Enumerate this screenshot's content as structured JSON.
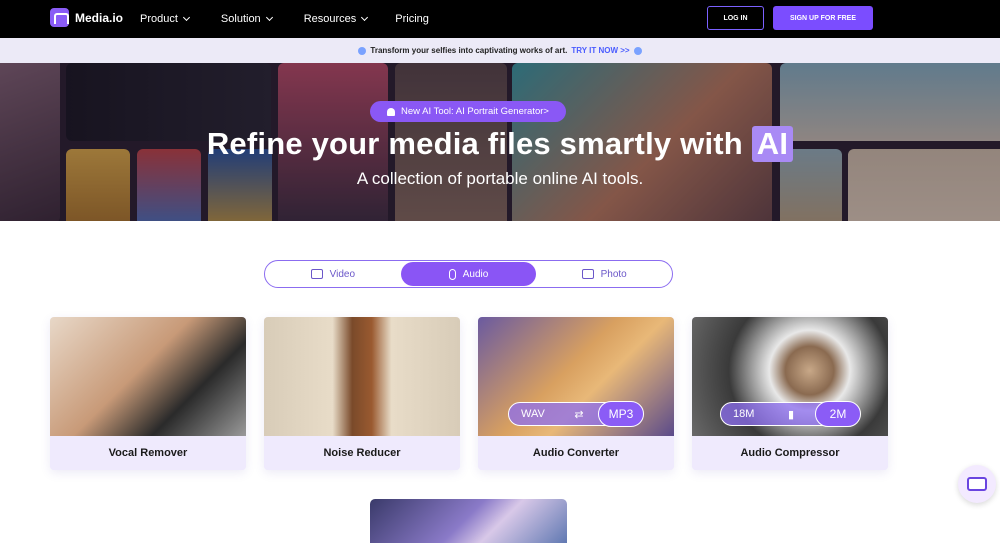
{
  "nav": {
    "logo_text": "Media.io",
    "menu": [
      {
        "label": "Product",
        "has_dropdown": true
      },
      {
        "label": "Solution",
        "has_dropdown": true
      },
      {
        "label": "Resources",
        "has_dropdown": true
      },
      {
        "label": "Pricing",
        "has_dropdown": false
      }
    ],
    "login_label": "LOG IN",
    "signup_label": "SIGN UP FOR FREE"
  },
  "promo": {
    "text": "Transform your selfies into captivating works of art.",
    "link": "TRY IT NOW >>"
  },
  "hero": {
    "badge": "New AI Tool: AI Portrait Generator>",
    "title_prefix": "Refine your media files smartly with",
    "title_highlight": "AI",
    "subtitle": "A collection of portable online AI tools."
  },
  "tabs": [
    {
      "label": "Video",
      "icon": "video-icon",
      "active": false
    },
    {
      "label": "Audio",
      "icon": "microphone-icon",
      "active": true
    },
    {
      "label": "Photo",
      "icon": "image-icon",
      "active": false
    }
  ],
  "cards": [
    {
      "label": "Vocal Remover"
    },
    {
      "label": "Noise Reducer"
    },
    {
      "label": "Audio Converter",
      "from": "WAV",
      "to": "MP3"
    },
    {
      "label": "Audio Compressor",
      "from": "18M",
      "to": "2M"
    }
  ],
  "colors": {
    "accent": "#8a55f5",
    "nav_bg": "#000000",
    "promo_bg": "#eceaf7",
    "card_label_bg": "#efeafd"
  }
}
